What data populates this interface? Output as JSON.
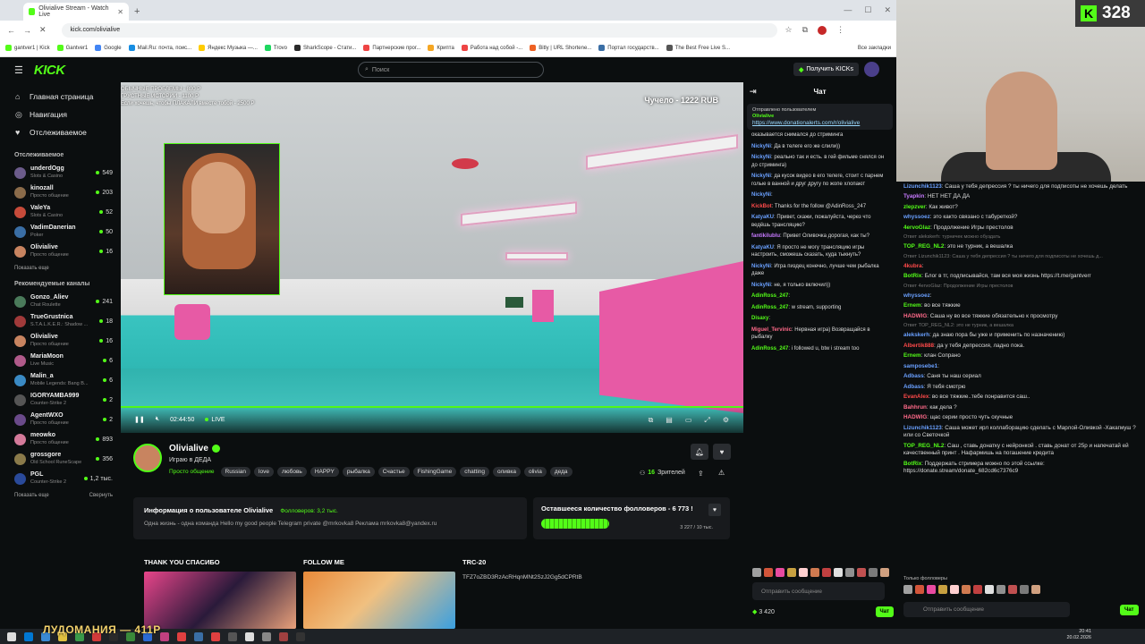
{
  "browser": {
    "tab_title": "Olivialive Stream - Watch Live",
    "url": "kick.com/olivialive",
    "bookmarks": [
      "gantver1 | Kick",
      "Gantver1",
      "Google",
      "Mail.Ru: почта, поис...",
      "Яндекс Музыка —...",
      "Trovo",
      "SharkScope - Стати...",
      "Партнерские прог...",
      "Крипта",
      "Работа над собой -...",
      "Bitly | URL Shortene...",
      "Портал государств...",
      "The Best Free Live S..."
    ],
    "bookmarks_all": "Все закладки"
  },
  "header": {
    "logo": "KICK",
    "search_placeholder": "Поиск",
    "get_kicks": "Получить KICKs"
  },
  "sidebar": {
    "nav": [
      {
        "label": "Главная страница",
        "icon": "home-icon"
      },
      {
        "label": "Навигация",
        "icon": "compass-icon"
      },
      {
        "label": "Отслеживаемое",
        "icon": "heart-icon"
      }
    ],
    "following_title": "Отслеживаемое",
    "following": [
      {
        "name": "underdOgg",
        "cat": "Slots & Casino",
        "viewers": "549",
        "color": "#6b5b8a"
      },
      {
        "name": "kinozall",
        "cat": "Просто общение",
        "viewers": "203",
        "color": "#8a6b4a"
      },
      {
        "name": "ValeYa",
        "cat": "Slots & Casino",
        "viewers": "52",
        "color": "#c74b3a"
      },
      {
        "name": "VadimDanerian",
        "cat": "Poker",
        "viewers": "50",
        "color": "#3a6ea5"
      },
      {
        "name": "Olivialive",
        "cat": "Просто общение",
        "viewers": "16",
        "color": "#c88460"
      }
    ],
    "show_more": "Показать еще",
    "recommended_title": "Рекомендуемые каналы",
    "recommended": [
      {
        "name": "Gonzo_Aliev",
        "cat": "Chat Roulette",
        "viewers": "241",
        "color": "#4a7a5a"
      },
      {
        "name": "TrueGrustnica",
        "cat": "S.T.A.L.K.E.R.: Shadow ...",
        "viewers": "18",
        "color": "#a03a3a"
      },
      {
        "name": "Olivialive",
        "cat": "Просто общение",
        "viewers": "16",
        "color": "#c88460"
      },
      {
        "name": "MariaMoon",
        "cat": "Live Music",
        "viewers": "6",
        "color": "#b05a8a"
      },
      {
        "name": "Malin_a",
        "cat": "Mobile Legends: Bang B...",
        "viewers": "6",
        "color": "#3a8ac4"
      },
      {
        "name": "IGORYAMBA999",
        "cat": "Counter-Strike 2",
        "viewers": "2",
        "color": "#555"
      },
      {
        "name": "AgentWXO",
        "cat": "Просто общение",
        "viewers": "2",
        "color": "#6a4a8a"
      },
      {
        "name": "meowko",
        "cat": "Просто общение",
        "viewers": "893",
        "color": "#d47a9a"
      },
      {
        "name": "grossgore",
        "cat": "Old School RuneScape",
        "viewers": "356",
        "color": "#8a7a4a"
      },
      {
        "name": "PGL",
        "cat": "Counter-Strike 2",
        "viewers": "1,2 тыс.",
        "color": "#2a4a9a"
      }
    ],
    "show_more2": "Показать еще",
    "collapse": "Свернуть"
  },
  "player": {
    "overlay_top": [
      "ОБЫЧНЫЕ ПРОБЛЕМЫ - 800 Р",
      "ГРУСТНЫЕ ИСТОРИИ - 1100 Р",
      "Если хочешь, чтобы ПЛАКАЛИ вместе тобой - 2500 Р"
    ],
    "overlay_chu": "Чучело - 1222 RUB",
    "time": "02:44:50",
    "live": "LIVE"
  },
  "channel": {
    "name": "Olivialive",
    "title": "Играю в ДЕДА",
    "category": "Просто общение",
    "tags": [
      "Russian",
      "love",
      "любовь",
      "HAPPY",
      "рыбалка",
      "Счастье",
      "FishingGame",
      "chatting",
      "оливка",
      "olivia",
      "деда"
    ],
    "viewers_count": "16",
    "viewers_label": "Зрителей",
    "about_title": "Информация о пользователе Olivialive",
    "followers": "Фолловеров: 3,2 тыс.",
    "about_text": "Одна жизнь - одна команда Hello my good people    Telegram private @mrkovka8 Реклама mrkovka8@yandex.ru",
    "goal_title": "Оставшееся количество фолловеров - 6 773 !",
    "goal_progress": "3 227 / 10 тыс.",
    "goal_fraction": 0.32,
    "panels": [
      "THANK YOU СПАСИБО",
      "FOLLOW ME",
      "TRC-20"
    ],
    "trc_address": "TFZ7oZBD3RzAcRHqnMNt2SzJ2Gg5dCPRtB"
  },
  "chat": {
    "title": "Чат",
    "pinned_by": "Отправлено пользователем",
    "pinned_user": "Olivialive",
    "pinned_link": "https://www.donationalerts.com/r/olivialive",
    "messages": [
      {
        "u": "",
        "c": "#ddd",
        "t": "оказывается снимался до стриминга"
      },
      {
        "u": "NickyNi",
        "c": "#6aa0ff",
        "t": "Да в телеге его же слили))"
      },
      {
        "u": "NickyNi",
        "c": "#6aa0ff",
        "t": "реально так и есть. в гей фильме снялся он до стриминга)"
      },
      {
        "u": "NickyNi",
        "c": "#6aa0ff",
        "t": "да кусок видео в его телеге, стоит с парнем голые в ванной и друг другу по жопе хлопают"
      },
      {
        "u": "NickyNi",
        "c": "#6aa0ff",
        "t": ""
      },
      {
        "u": "KickBot",
        "c": "#ff4a4a",
        "t": "Thanks for the follow @AdinRoss_247"
      },
      {
        "u": "KatyaKU",
        "c": "#6aa0ff",
        "t": "Привет, скажи, пожалуйста, через что ведёшь трансляцию?"
      },
      {
        "u": "fantikilublu",
        "c": "#c77aff",
        "t": "Привет Оливочка дорогая, как ты?"
      },
      {
        "u": "KatyaKU",
        "c": "#6aa0ff",
        "t": "Я просто не могу трансляцию игры настроить, сможешь сказать, куда тыкнуть?"
      },
      {
        "u": "NickyNi",
        "c": "#6aa0ff",
        "t": "Игра пиздец конечно, лучше чем рыбалка даже"
      },
      {
        "u": "NickyNi",
        "c": "#6aa0ff",
        "t": "не, я только включил))"
      },
      {
        "u": "AdinRoss_247",
        "c": "#53fc18",
        "t": ""
      },
      {
        "u": "AdinRoss_247",
        "c": "#53fc18",
        "t": "w stream, supporting"
      },
      {
        "u": "Disaxy",
        "c": "#53fc18",
        "t": ""
      },
      {
        "u": "Miguel_Tervinic",
        "c": "#ff6a8a",
        "t": "Нервная игра) Возвращайся в рыбалку"
      },
      {
        "u": "AdinRoss_247",
        "c": "#53fc18",
        "t": "i followed u, btw i stream too"
      }
    ],
    "input_placeholder": "Отправить сообщение",
    "kicks": "3 420",
    "send": "Чат"
  },
  "cam": {
    "kick_count": "328"
  },
  "bigchat": {
    "messages": [
      {
        "u": "Lizunchik1123",
        "c": "#6aa0ff",
        "t": "Саша у тебя депрессия ? ты ничего для подписоты не хочешь делать",
        "sys": false
      },
      {
        "u": "Tyapkin",
        "c": "#c77aff",
        "t": "НЕТ НЕТ ДА ДА",
        "sys": false
      },
      {
        "u": "zlepzver",
        "c": "#53fc18",
        "t": "Как живот?",
        "sys": false
      },
      {
        "u": "whyssoez",
        "c": "#6aa0ff",
        "t": "это както связано с табуреткой?",
        "sys": false
      },
      {
        "u": "4ervoGlaz",
        "c": "#53fc18",
        "t": "Продолжение Игры престолов",
        "sys": false
      },
      {
        "u": "",
        "c": "",
        "t": "Ответ alekskerh: турничек можно обуздать",
        "sys": true
      },
      {
        "u": "TOP_REG_NL2",
        "c": "#53fc18",
        "t": "это не турник, а вешалка",
        "sys": false
      },
      {
        "u": "",
        "c": "",
        "t": "Ответ Lizunchik1123: Саша у тебя депрессия ? ты ничего для подписоты не хочешь д...",
        "sys": true
      },
      {
        "u": "4kubra",
        "c": "#ff4a4a",
        "t": "",
        "sys": false
      },
      {
        "u": "BotRix",
        "c": "#53fc18",
        "t": "Блог в тг, подписывайся, там вся моя жизнь https://t.me/gantverr",
        "sys": false
      },
      {
        "u": "",
        "c": "",
        "t": "Ответ 4ervoGlaz: Продолжение Игры престолов",
        "sys": true
      },
      {
        "u": "whyssoez",
        "c": "#6aa0ff",
        "t": "",
        "sys": false
      },
      {
        "u": "Ernem",
        "c": "#53fc18",
        "t": "во все тяжкие",
        "sys": false
      },
      {
        "u": "HADWIG",
        "c": "#ff6a8a",
        "t": "Саша ну во все тяжкие обязательно к просмотру",
        "sys": false
      },
      {
        "u": "",
        "c": "",
        "t": "Ответ TOP_REG_NL2: это не турник, а вешалка",
        "sys": true
      },
      {
        "u": "alekskerh",
        "c": "#6aa0ff",
        "t": "да знаю пора бы уже и применить по назначению)",
        "sys": false
      },
      {
        "u": "Albertik888",
        "c": "#ff4a4a",
        "t": "да у тебя депрессия, ладно пока.",
        "sys": false
      },
      {
        "u": "Ernem",
        "c": "#53fc18",
        "t": "клан Сопрано",
        "sys": false
      },
      {
        "u": "samposebe1",
        "c": "#6aa0ff",
        "t": "",
        "sys": false
      },
      {
        "u": "Adbass",
        "c": "#6aa0ff",
        "t": "Саня ты наш сериал",
        "sys": false
      },
      {
        "u": "Adbass",
        "c": "#6aa0ff",
        "t": "Я тебя смотрю",
        "sys": false
      },
      {
        "u": "EvanAlex",
        "c": "#ff4a4a",
        "t": "во все тяжкие..тебе понравится саш..",
        "sys": false
      },
      {
        "u": "Bahhrun",
        "c": "#ff6a8a",
        "t": "как дела ?",
        "sys": false
      },
      {
        "u": "HADWIG",
        "c": "#ff6a8a",
        "t": "щас серии просто чуть скучные",
        "sys": false
      },
      {
        "u": "Lizunchik1123",
        "c": "#6aa0ff",
        "t": "Саша может ирл коллаборацию сделать с Марлой-Оливкой -Хакагмуш ? или со Светочкой",
        "sys": false
      },
      {
        "u": "TOP_REG_NL2",
        "c": "#53fc18",
        "t": "Саш , ставь донатку с нейронкой . ставь донат от 25р и напечатай ей качественный принт . Нафармишь на погашение кредита",
        "sys": false
      },
      {
        "u": "BotRix",
        "c": "#53fc18",
        "t": "Поддержать стримера можно по этой ссылке: https://donate.stream/donate_682cd6c7376c9",
        "sys": false
      }
    ],
    "follow_only": "Только фолловеры",
    "input_placeholder": "Отправить сообщение",
    "send": "Чат"
  },
  "overlay_banner": "ЛУДОМАНИЯ — 411Р",
  "clock": {
    "time": "20:41",
    "date": "20.02.2026",
    "lang": "ENG"
  }
}
